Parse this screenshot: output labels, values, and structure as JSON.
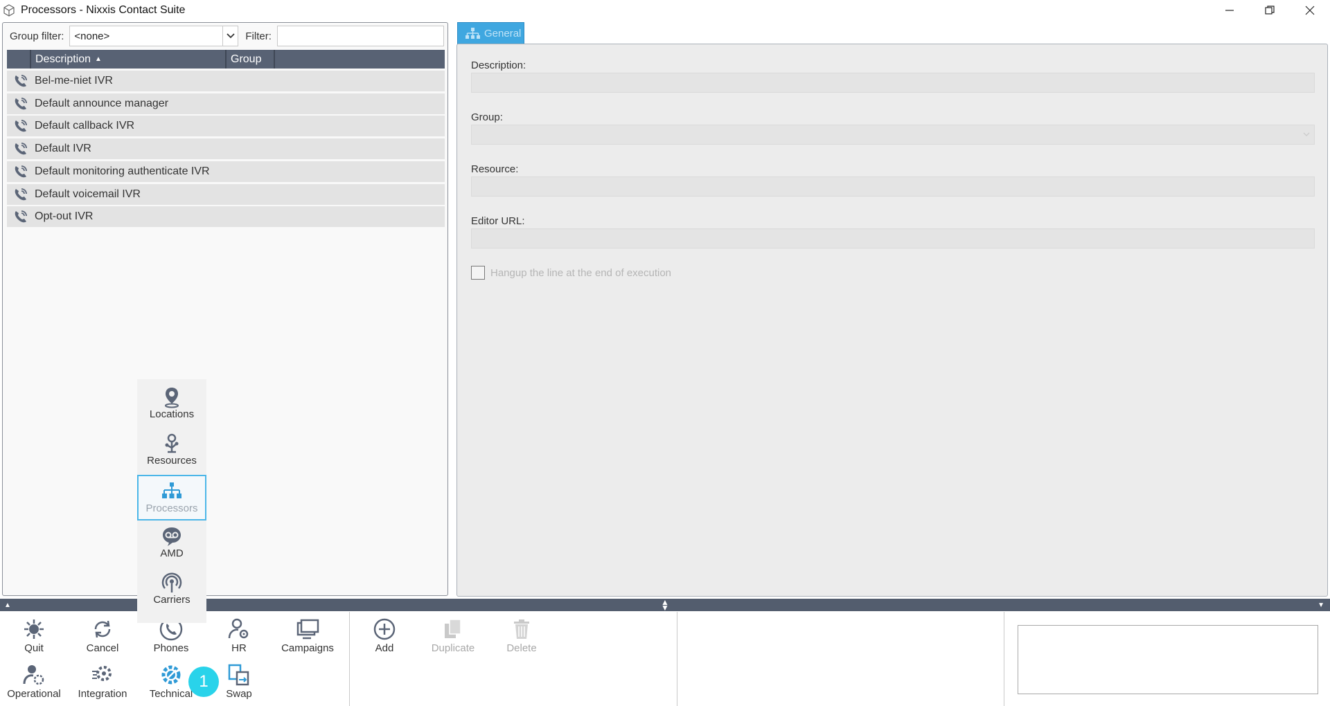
{
  "window": {
    "title": "Processors - Nixxis Contact Suite",
    "app_icon": "cube-icon",
    "controls": [
      "minimize-icon",
      "restore-icon",
      "close-icon"
    ]
  },
  "list_panel": {
    "group_filter_label": "Group filter:",
    "group_filter_value": "<none>",
    "filter_label": "Filter:",
    "filter_value": "",
    "columns": [
      "Description",
      "Group"
    ],
    "sort_indicator": "▲",
    "rows": [
      {
        "description": "Bel-me-niet IVR",
        "group": ""
      },
      {
        "description": "Default announce manager",
        "group": ""
      },
      {
        "description": "Default callback IVR",
        "group": ""
      },
      {
        "description": "Default IVR",
        "group": ""
      },
      {
        "description": "Default monitoring authenticate IVR",
        "group": ""
      },
      {
        "description": "Default voicemail IVR",
        "group": ""
      },
      {
        "description": "Opt-out IVR",
        "group": ""
      }
    ],
    "row_icon": "phone-ivr-icon"
  },
  "details": {
    "tab_label": "General",
    "description_label": "Description:",
    "description_value": "",
    "group_label": "Group:",
    "group_value": "",
    "resource_label": "Resource:",
    "resource_value": "",
    "editor_url_label": "Editor URL:",
    "editor_url_value": "",
    "hangup_label": "Hangup the line at the end of execution",
    "hangup_checked": false
  },
  "popup_menu": {
    "items": [
      {
        "label": "Locations",
        "icon": "location-pin-icon"
      },
      {
        "label": "Resources",
        "icon": "resources-icon"
      },
      {
        "label": "Processors",
        "icon": "org-chart-icon",
        "active": true
      },
      {
        "label": "AMD",
        "icon": "voicemail-icon"
      },
      {
        "label": "Carriers",
        "icon": "antenna-icon"
      }
    ]
  },
  "toolbar": {
    "quit": "Quit",
    "cancel": "Cancel",
    "phones": "Phones",
    "hr": "HR",
    "campaigns": "Campaigns",
    "operational": "Operational",
    "integration": "Integration",
    "technical": "Technical",
    "swap": "Swap",
    "add": "Add",
    "duplicate": "Duplicate",
    "delete": "Delete",
    "badge": "1"
  },
  "colors": {
    "accent": "#3fa7e0",
    "header": "#586274",
    "badge": "#29d3ea"
  }
}
